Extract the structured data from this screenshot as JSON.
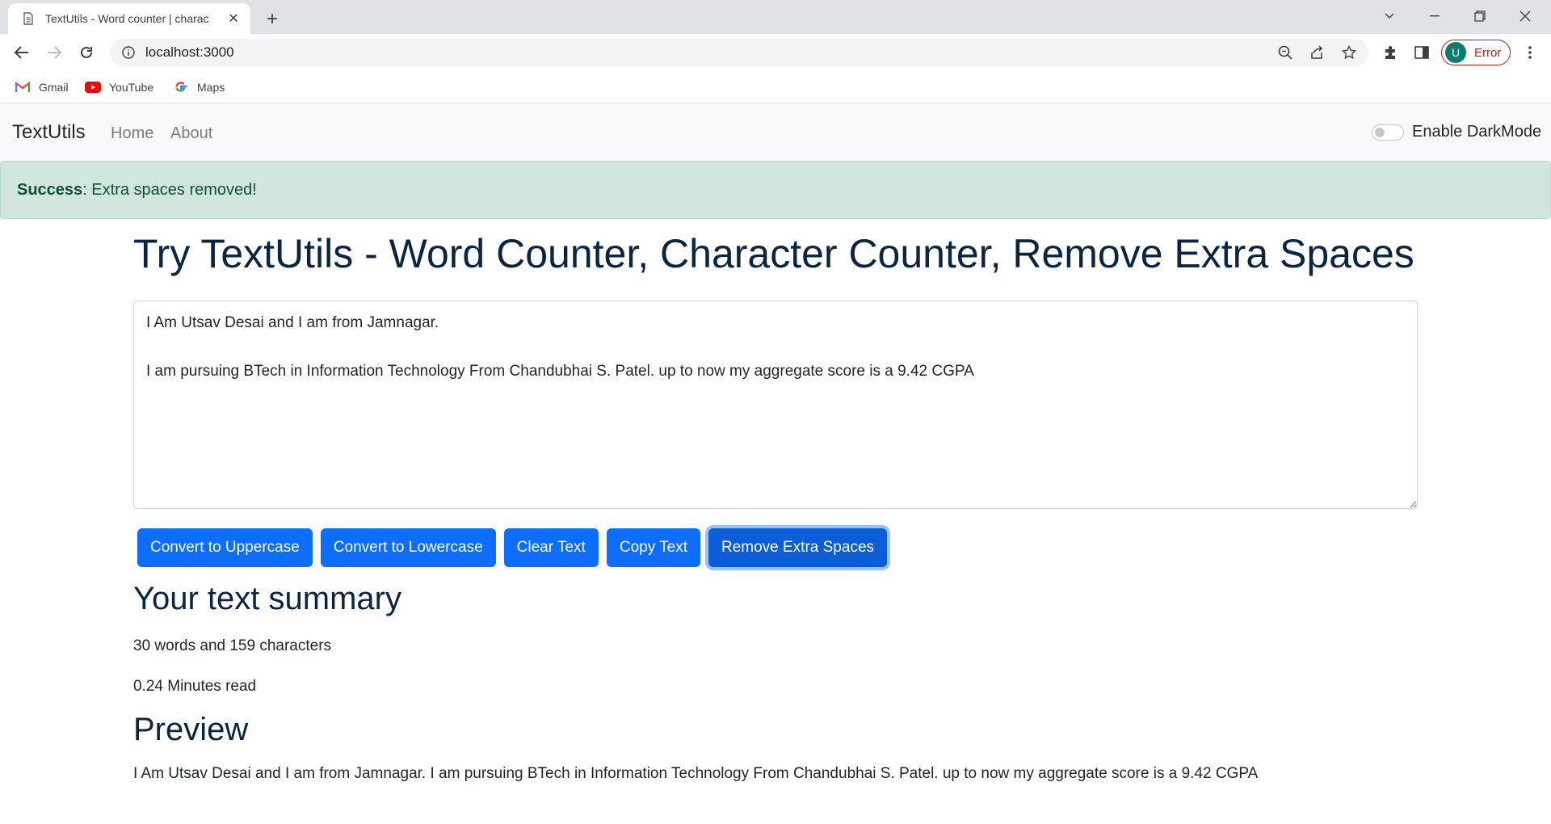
{
  "browser": {
    "tab_title": "TextUtils - Word counter | charac",
    "url": "localhost:3000",
    "profile_initial": "U",
    "profile_status": "Error",
    "bookmarks": [
      {
        "label": "Gmail",
        "icon": "gmail-icon"
      },
      {
        "label": "YouTube",
        "icon": "youtube-icon"
      },
      {
        "label": "Maps",
        "icon": "google-icon"
      }
    ]
  },
  "navbar": {
    "brand": "TextUtils",
    "links": [
      "Home",
      "About"
    ],
    "darkmode_label": "Enable DarkMode"
  },
  "alert": {
    "type": "Success",
    "message": ": Extra spaces removed!"
  },
  "main": {
    "heading": "Try TextUtils - Word Counter, Character Counter, Remove Extra Spaces",
    "text_value": "I Am Utsav Desai and I am from Jamnagar.\n\nI am pursuing BTech in Information Technology From Chandubhai S. Patel. up to now my aggregate score is a 9.42 CGPA",
    "buttons": [
      "Convert to Uppercase",
      "Convert to Lowercase",
      "Clear Text",
      "Copy Text",
      "Remove Extra Spaces"
    ]
  },
  "summary": {
    "heading": "Your text summary",
    "counts": "30 words and 159 characters",
    "read_time": "0.24 Minutes read"
  },
  "preview": {
    "heading": "Preview",
    "text": "I Am Utsav Desai and I am from Jamnagar. I am pursuing BTech in Information Technology From Chandubhai S. Patel. up to now my aggregate score is a 9.42 CGPA"
  }
}
